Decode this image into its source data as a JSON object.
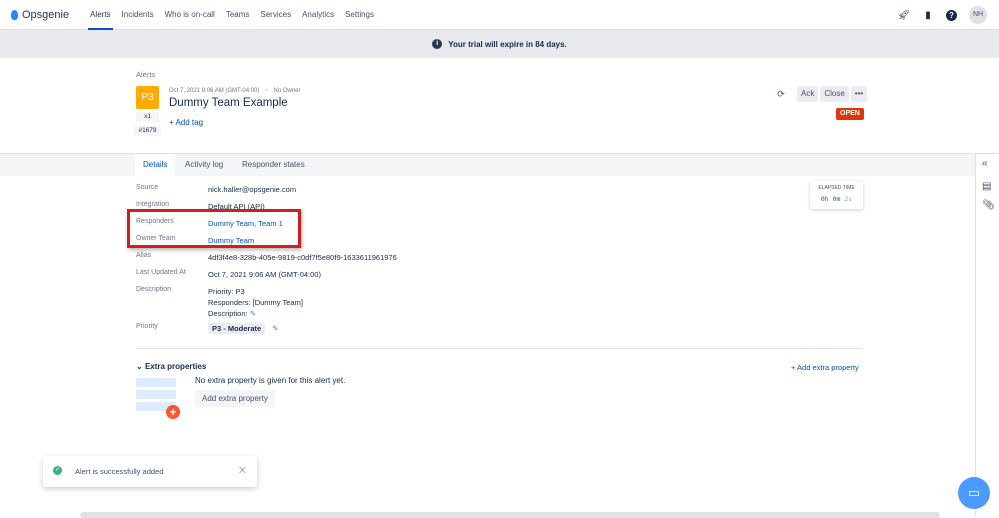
{
  "nav": {
    "brand": "Opsgenie",
    "items": [
      "Alerts",
      "Incidents",
      "Who is on-call",
      "Teams",
      "Services",
      "Analytics",
      "Settings"
    ],
    "avatar": "NH"
  },
  "banner": {
    "text": "Your trial will expire in 84 days."
  },
  "alert": {
    "breadcrumb": "Alerts",
    "priority": "P3",
    "count": "x1",
    "number": "#1679",
    "created": "Oct 7, 2021 9:06 AM (GMT-04:00)",
    "owner": "No Owner",
    "title": "Dummy Team Example",
    "add_tag": "+ Add tag",
    "status": "OPEN"
  },
  "actions": {
    "ack": "Ack",
    "close": "Close",
    "more": "•••"
  },
  "tabs": [
    "Details",
    "Activity log",
    "Responder states"
  ],
  "elapsed": {
    "label": "ELAPSED TIME",
    "h": "0h",
    "m": "0m",
    "s": "2s"
  },
  "details": {
    "source": {
      "label": "Source",
      "value": "nick.haller@opsgenie.com"
    },
    "integration": {
      "label": "Integration",
      "value": "Default API (API)"
    },
    "responders": {
      "label": "Responders",
      "value": "Dummy Team, Team 1"
    },
    "owner_team": {
      "label": "Owner Team",
      "value": "Dummy Team"
    },
    "alias": {
      "label": "Alias",
      "value": "4df3f4e8-328b-405e-9819-c0df7f5e80f9-1633611961976"
    },
    "updated": {
      "label": "Last Updated At",
      "value": "Oct 7, 2021 9:06 AM (GMT-04:00)"
    },
    "description": {
      "label": "Description",
      "lines": [
        "Priority: P3",
        "Responders: [Dummy Team]",
        "Description:"
      ]
    },
    "priority": {
      "label": "Priority",
      "value": "P3 - Moderate"
    }
  },
  "extra": {
    "title": "Extra properties",
    "add_link": "+ Add extra property",
    "empty": "No extra property is given for this alert yet.",
    "add_button": "Add extra property"
  },
  "toast": {
    "message": "Alert is successfully added"
  },
  "colors": {
    "accent": "#0052cc",
    "p3": "#ffab00",
    "open": "#de350b",
    "highlight": "#d01f1f"
  }
}
